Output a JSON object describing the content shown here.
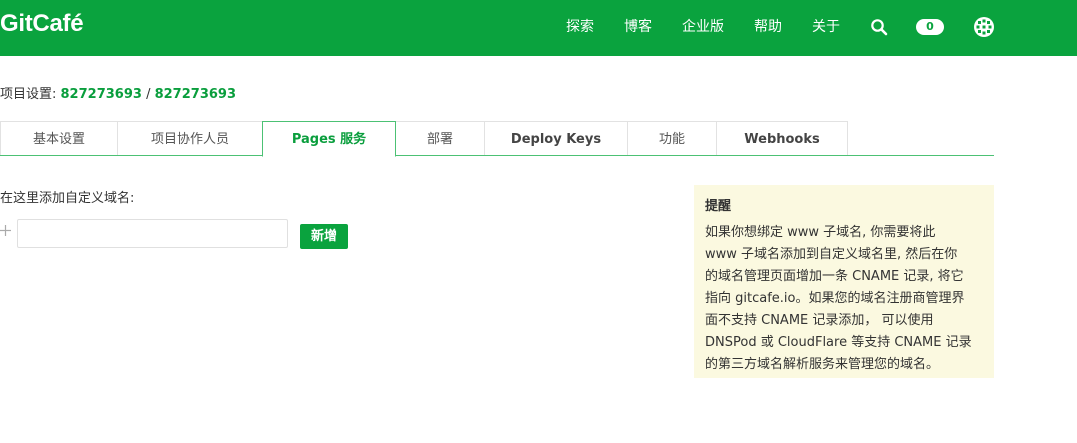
{
  "header": {
    "logo": "GitCafé",
    "nav": [
      "探索",
      "博客",
      "企业版",
      "帮助",
      "关于"
    ],
    "notification_count": "0"
  },
  "breadcrumb": {
    "prefix": "项目设置: ",
    "owner": "827273693",
    "separator": " / ",
    "repo": "827273693"
  },
  "tabs": [
    "基本设置",
    "项目协作人员",
    "Pages 服务",
    "部署",
    "Deploy Keys",
    "功能",
    "Webhooks"
  ],
  "form": {
    "label": "在这里添加自定义域名:",
    "input_value": "",
    "add_button": "新增"
  },
  "tip": {
    "title": "提醒",
    "lines": [
      "如果你想绑定 www 子域名, 你需要将此",
      "www 子域名添加到自定义域名里, 然后在你",
      "的域名管理页面增加一条 CNAME 记录, 将它",
      "指向 gitcafe.io。如果您的域名注册商管理界",
      "面不支持 CNAME 记录添加， 可以使用",
      "DNSPod 或 CloudFlare 等支持 CNAME 记录",
      "的第三方域名解析服务来管理您的域名。"
    ]
  },
  "colors": {
    "brand": "#0aa33e",
    "tip_background": "#fbf9e0"
  }
}
